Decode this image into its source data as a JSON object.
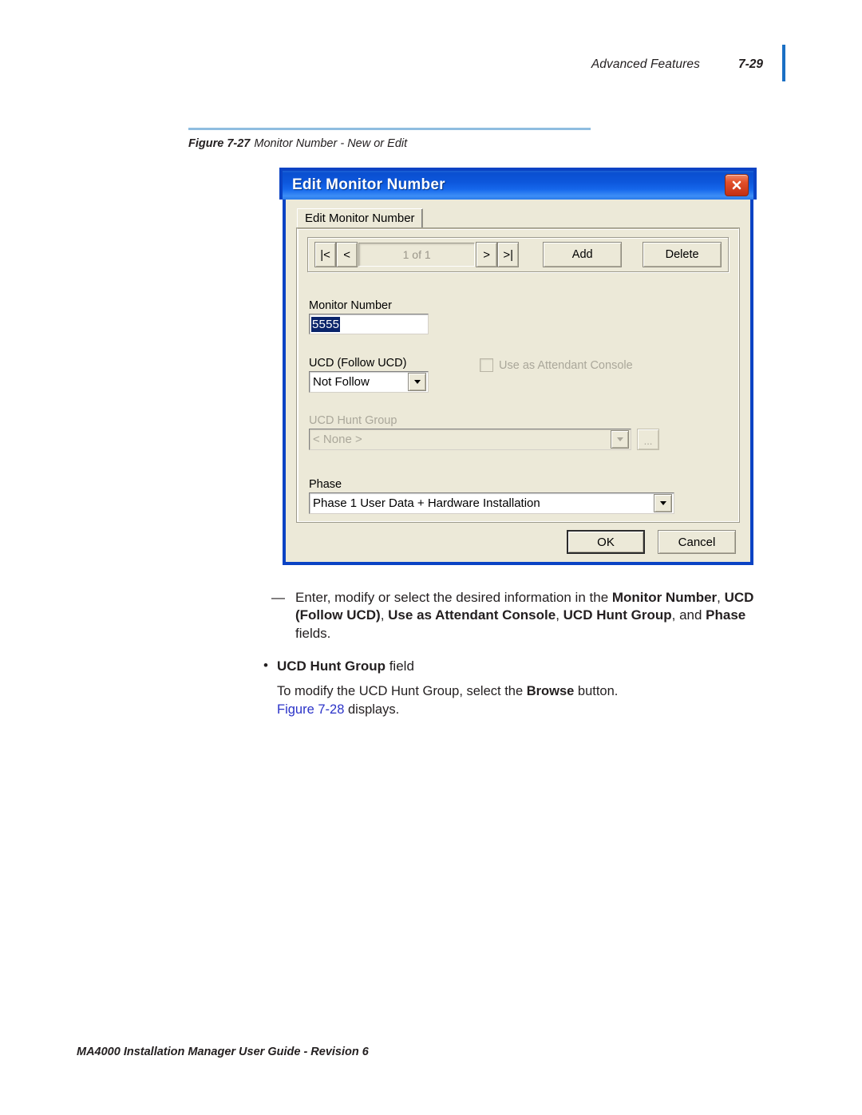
{
  "header": {
    "chapter": "Advanced Features",
    "page_number": "7-29",
    "rule_color": "#1a6fc4"
  },
  "figure": {
    "rule_color": "#8fbde0",
    "label": "Figure 7-27",
    "title": "Monitor Number - New or Edit"
  },
  "dialog": {
    "title": "Edit Monitor Number",
    "close_icon": "close-icon",
    "tab_label": "Edit Monitor Number",
    "navigation": {
      "first_label": "|<",
      "prev_label": "<",
      "counter": "1 of 1",
      "next_label": ">",
      "last_label": ">|",
      "add_label": "Add",
      "delete_label": "Delete"
    },
    "fields": {
      "monitor_number_label": "Monitor Number",
      "monitor_number_value": "5555",
      "ucd_follow_label": "UCD (Follow UCD)",
      "ucd_follow_value": "Not Follow",
      "attendant_console_label": "Use as Attendant Console",
      "attendant_console_checked": "false",
      "hunt_group_label": "UCD Hunt Group",
      "hunt_group_value": "< None >",
      "browse_label": "...",
      "phase_label": "Phase",
      "phase_value": "Phase 1 User Data + Hardware Installation"
    },
    "buttons": {
      "ok_label": "OK",
      "cancel_label": "Cancel"
    }
  },
  "body": {
    "dash_mark": "—",
    "dash_part1": "Enter, modify or select the desired information in the ",
    "dash_bold1": "Monitor Number",
    "dash_sep1": ", ",
    "dash_bold2": "UCD (Follow UCD)",
    "dash_sep2": ", ",
    "dash_bold3": "Use as Attendant Console",
    "dash_sep3": ", ",
    "dash_bold4": "UCD Hunt Group",
    "dash_sep4": ", and ",
    "dash_bold5": "Phase",
    "dash_end": " fields.",
    "bullet_mark": "•",
    "bullet_bold": "UCD Hunt Group",
    "bullet_rest": " field",
    "sub_part1": "To modify the UCD Hunt Group, select the ",
    "sub_bold": "Browse",
    "sub_part2": " button.",
    "sub_xref": "Figure 7-28",
    "sub_part3": " displays."
  },
  "footer": {
    "text": "MA4000 Installation Manager User Guide - Revision 6"
  }
}
